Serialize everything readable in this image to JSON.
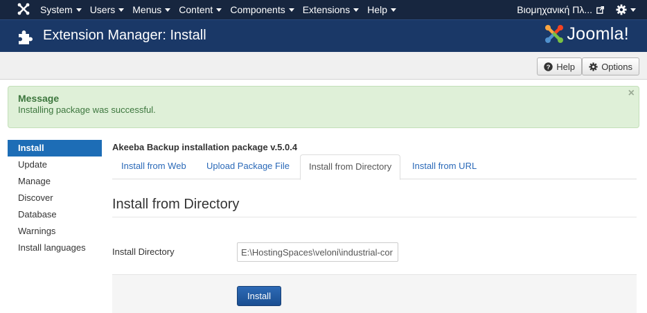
{
  "navbar": {
    "menu": [
      {
        "label": "System"
      },
      {
        "label": "Users"
      },
      {
        "label": "Menus"
      },
      {
        "label": "Content"
      },
      {
        "label": "Components"
      },
      {
        "label": "Extensions"
      },
      {
        "label": "Help"
      }
    ],
    "site_name": "Βιομηχανική Πλ...",
    "settings_icon": "gear-icon"
  },
  "header": {
    "title": "Extension Manager: Install",
    "brand": "Joomla!",
    "icon": "puzzle-icon"
  },
  "toolbar": {
    "help_label": "Help",
    "options_label": "Options"
  },
  "message": {
    "heading": "Message",
    "text": "Installing package was successful.",
    "close": "×"
  },
  "sidebar": {
    "items": [
      {
        "label": "Install",
        "active": true
      },
      {
        "label": "Update"
      },
      {
        "label": "Manage"
      },
      {
        "label": "Discover"
      },
      {
        "label": "Database"
      },
      {
        "label": "Warnings"
      },
      {
        "label": "Install languages"
      }
    ]
  },
  "main": {
    "package_title": "Akeeba Backup installation package v.5.0.4",
    "tabs": [
      {
        "label": "Install from Web"
      },
      {
        "label": "Upload Package File"
      },
      {
        "label": "Install from Directory",
        "active": true
      },
      {
        "label": "Install from URL"
      }
    ],
    "section_title": "Install from Directory",
    "field_label": "Install Directory",
    "field_value": "E:\\HostingSpaces\\veloni\\industrial-cor",
    "install_label": "Install"
  },
  "colors": {
    "navbar": "#17263f",
    "header": "#1a3867",
    "accent": "#1d6db6",
    "success_bg": "#dff0d8",
    "success_text": "#3c763d"
  }
}
